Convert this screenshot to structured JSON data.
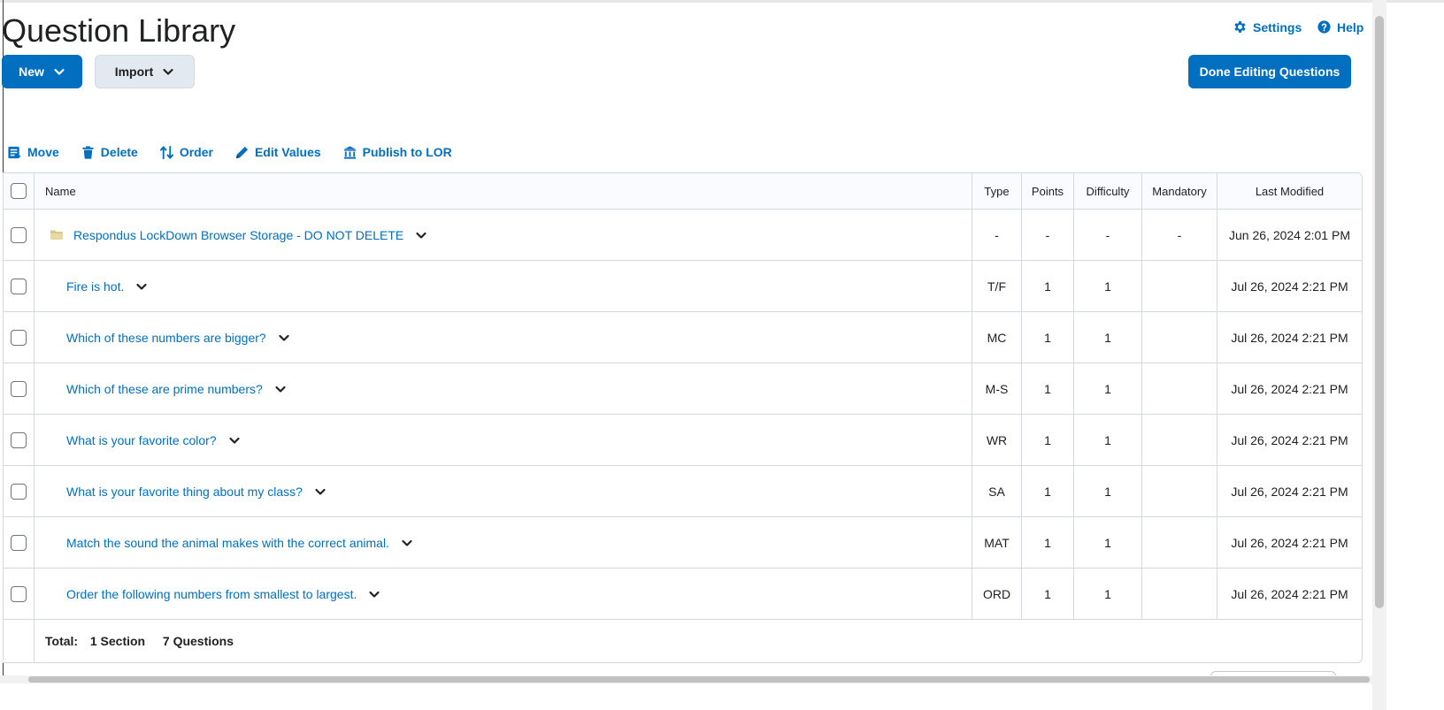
{
  "page": {
    "title": "Question Library"
  },
  "topLinks": {
    "settings": "Settings",
    "help": "Help"
  },
  "buttons": {
    "new": "New",
    "import": "Import",
    "done": "Done Editing Questions"
  },
  "toolbar": {
    "move": "Move",
    "delete": "Delete",
    "order": "Order",
    "editValues": "Edit Values",
    "publish": "Publish to LOR"
  },
  "table": {
    "headers": {
      "name": "Name",
      "type": "Type",
      "points": "Points",
      "difficulty": "Difficulty",
      "mandatory": "Mandatory",
      "modified": "Last Modified"
    },
    "rows": [
      {
        "name": "Respondus LockDown Browser Storage - DO NOT DELETE",
        "type": "-",
        "points": "-",
        "difficulty": "-",
        "mandatory": "-",
        "modified": "Jun 26, 2024 2:01 PM"
      },
      {
        "name": "Fire is hot.",
        "type": "T/F",
        "points": "1",
        "difficulty": "1",
        "mandatory": "",
        "modified": "Jul 26, 2024 2:21 PM"
      },
      {
        "name": "Which of these numbers are bigger?",
        "type": "MC",
        "points": "1",
        "difficulty": "1",
        "mandatory": "",
        "modified": "Jul 26, 2024 2:21 PM"
      },
      {
        "name": "Which of these are prime numbers?",
        "type": "M-S",
        "points": "1",
        "difficulty": "1",
        "mandatory": "",
        "modified": "Jul 26, 2024 2:21 PM"
      },
      {
        "name": "What is your favorite color?",
        "type": "WR",
        "points": "1",
        "difficulty": "1",
        "mandatory": "",
        "modified": "Jul 26, 2024 2:21 PM"
      },
      {
        "name": "What is your favorite thing about my class?",
        "type": "SA",
        "points": "1",
        "difficulty": "1",
        "mandatory": "",
        "modified": "Jul 26, 2024 2:21 PM"
      },
      {
        "name": "Match the sound the animal makes with the correct animal.",
        "type": "MAT",
        "points": "1",
        "difficulty": "1",
        "mandatory": "",
        "modified": "Jul 26, 2024 2:21 PM"
      },
      {
        "name": "Order the following numbers from smallest to largest.",
        "type": "ORD",
        "points": "1",
        "difficulty": "1",
        "mandatory": "",
        "modified": "Jul 26, 2024 2:21 PM"
      }
    ],
    "total": {
      "label": "Total:",
      "sections": "1 Section",
      "questions": "7 Questions"
    }
  },
  "colors": {
    "accent": "#006fbf",
    "border": "#d3d9e3",
    "secondaryButton": "#e3e9f1",
    "folder": "#d9c889"
  },
  "icons": {
    "settings": "gear-icon",
    "help": "question-circle-icon",
    "chevron": "chevron-down-icon",
    "move": "move-icon",
    "delete": "trash-icon",
    "order": "order-arrows-icon",
    "editValues": "pencil-icon",
    "publish": "publish-lor-icon",
    "folder": "folder-icon"
  }
}
